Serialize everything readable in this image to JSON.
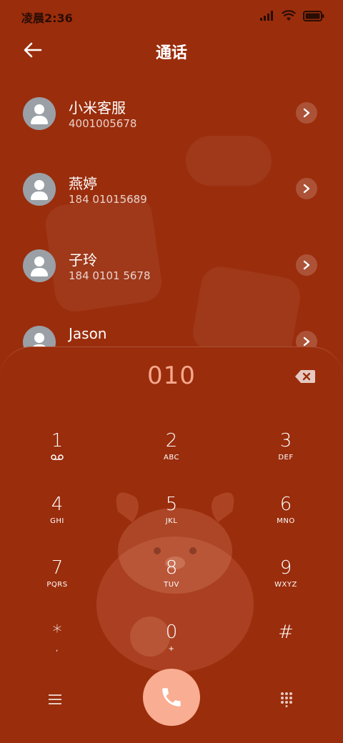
{
  "status_bar": {
    "time": "凌晨2:36",
    "signal_icon": "signal-icon",
    "wifi_icon": "wifi-icon",
    "battery_icon": "battery-icon"
  },
  "header": {
    "back_icon": "arrow-left-icon",
    "title": "通话"
  },
  "contacts": [
    {
      "name": "小米客服",
      "number": "4001005678"
    },
    {
      "name": "燕婷",
      "number": "184 01015689"
    },
    {
      "name": "子玲",
      "number": "184 0101 5678"
    },
    {
      "name": "Jason",
      "number": ""
    }
  ],
  "dialer": {
    "input": "010",
    "backspace_icon": "backspace-icon",
    "keys": [
      {
        "digit": "1",
        "letters": ""
      },
      {
        "digit": "2",
        "letters": "ABC"
      },
      {
        "digit": "3",
        "letters": "DEF"
      },
      {
        "digit": "4",
        "letters": "GHI"
      },
      {
        "digit": "5",
        "letters": "JKL"
      },
      {
        "digit": "6",
        "letters": "MNO"
      },
      {
        "digit": "7",
        "letters": "PQRS"
      },
      {
        "digit": "8",
        "letters": "TUV"
      },
      {
        "digit": "9",
        "letters": "WXYZ"
      },
      {
        "digit": "*",
        "letters": ","
      },
      {
        "digit": "0",
        "letters": "+"
      },
      {
        "digit": "#",
        "letters": ""
      }
    ],
    "menu_icon": "menu-icon",
    "call_icon": "phone-icon",
    "keypad_icon": "dialpad-icon"
  },
  "colors": {
    "background": "#9a2d0c",
    "accent": "#f6a88c",
    "call_button": "#f9ad92"
  }
}
